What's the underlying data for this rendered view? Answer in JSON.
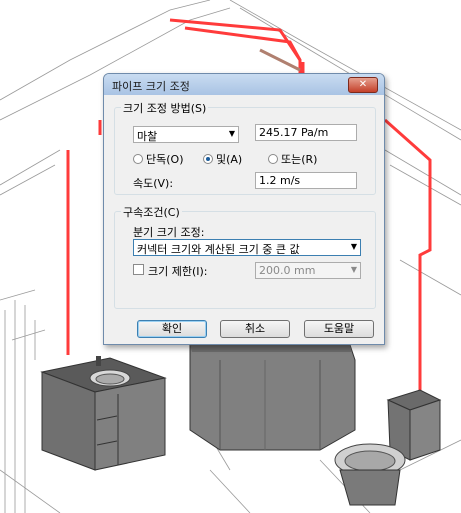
{
  "dialog": {
    "title": "파이프 크기 조정",
    "close_glyph": "✕",
    "method_group": "크기 조정 방법(S)",
    "method_value": "마찰",
    "friction_value": "245.17 Pa/m",
    "radio_only": "단독(O)",
    "radio_and": "및(A)",
    "radio_or": "또는(R)",
    "velocity_label": "속도(V):",
    "velocity_value": "1.2 m/s",
    "constraints_group": "구속조건(C)",
    "branch_label": "분기 크기 조정:",
    "branch_value": "커넥터 크기와 계산된 크기 중 큰 값",
    "limit_label": "크기 제한(I):",
    "limit_value": "200.0 mm",
    "ok_label": "확인",
    "cancel_label": "취소",
    "help_label": "도움말"
  },
  "colors": {
    "pipe": "#ff3b3b",
    "titlebar": "#b9d1ea",
    "fixture": "#6e6e6e"
  }
}
